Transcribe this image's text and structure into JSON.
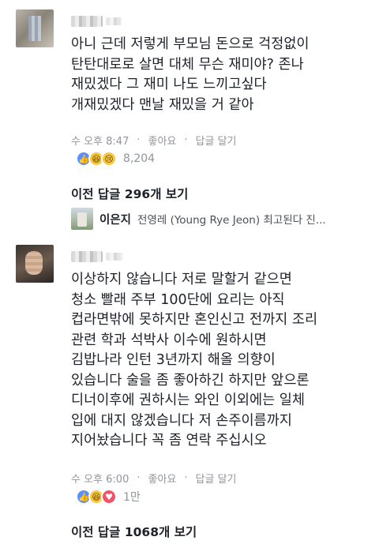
{
  "comment1": {
    "lines": [
      "아니 근데 저렇게 부모님 돈으로 걱정없이",
      "탄탄대로로 살면 대체 무슨 재미야? 존나",
      "재밌겠다 그 재미 나도 느끼고싶다",
      "개재밌겠다 맨날 재밌을 거 같아"
    ],
    "time": "수 오후 8:47",
    "like_label": "좋아요",
    "reply_label": "답글 달기",
    "reactions": [
      "like",
      "haha",
      "sad"
    ],
    "reaction_count": "8,204",
    "more_replies": "이전 답글 296개 보기"
  },
  "reply_preview": {
    "name": "이은지",
    "text": "전영레 (Young Rye Jeon) 최고된다 진..."
  },
  "comment2": {
    "lines": [
      "이상하지 않습니다 저로 말할거 같으면",
      "청소 빨래 주부 100단에 요리는 아직",
      "컵라면밖에 못하지만 혼인신고 전까지 조리",
      "관련 학과 석박사 이수에 원하시면",
      "김밥나라 인턴 3년까지 해올 의향이",
      "있습니다 술을 좀 좋아하긴 하지만 앞으론",
      "디너이후에 권하시는 와인 이외에는 일체",
      "입에 대지 않겠습니다 저 손주이름까지",
      "지어놨습니다 꼭 좀 연락 주십시오"
    ],
    "time": "수 오후 6:00",
    "like_label": "좋아요",
    "reply_label": "답글 달기",
    "reactions": [
      "like",
      "haha",
      "love"
    ],
    "reaction_count": "1만",
    "more_replies": "이전 답글 1068개 보기"
  },
  "separator": "·",
  "icons": {
    "like": "thumbs-up-icon",
    "haha": "haha-emoji-icon",
    "sad": "sad-emoji-icon",
    "love": "heart-icon"
  },
  "colors": {
    "text": "#1d2129",
    "meta": "#90949c",
    "like_blue": "#5890ff",
    "love_red": "#f25268",
    "emoji_yellow": "#f7c73f"
  }
}
